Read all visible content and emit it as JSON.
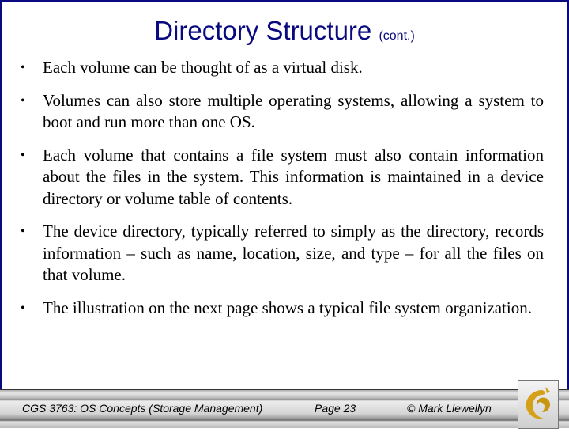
{
  "slide": {
    "title": "Directory Structure",
    "title_suffix": "(cont.)",
    "bullet_glyph": "•",
    "bullets": [
      "Each volume can be thought of as a virtual disk.",
      "Volumes can also store multiple operating systems, allowing a system to boot and run more than one OS.",
      "Each volume that contains a file system must also contain information about the files in the system.  This information is maintained in a device directory or volume table of contents.",
      "The device directory, typically referred to simply as the directory, records information – such as name, location, size, and type – for all the files on that volume.",
      "The illustration on the next page shows a typical file system organization."
    ]
  },
  "footer": {
    "course": "CGS 3763: OS Concepts  (Storage Management)",
    "page": "Page 23",
    "author": "© Mark Llewellyn",
    "logo": "ucf-pegasus-logo"
  },
  "colors": {
    "title": "#0a0a80",
    "frame": "#0a0a80",
    "logo_gold": "#d4a017"
  }
}
